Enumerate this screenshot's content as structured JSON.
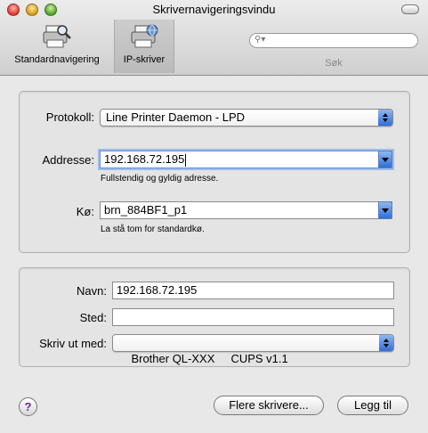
{
  "window": {
    "title": "Skrivernavigeringsvindu"
  },
  "toolbar": {
    "items": [
      {
        "label": "Standardnavigering",
        "icon": "printer-magnifier-icon"
      },
      {
        "label": "IP-skriver",
        "icon": "network-printer-icon",
        "selected": true
      }
    ],
    "search": {
      "placeholder": "",
      "label": "Søk"
    }
  },
  "ip_group": {
    "protocol_label": "Protokoll:",
    "protocol_value": "Line Printer Daemon - LPD",
    "address_label": "Addresse:",
    "address_value": "192.168.72.195",
    "address_hint": "Fullstendig og gyldig adresse.",
    "queue_label": "Kø:",
    "queue_value": "brn_884BF1_p1",
    "queue_hint": "La stå tom for standardkø."
  },
  "info_group": {
    "name_label": "Navn:",
    "name_value": "192.168.72.195",
    "location_label": "Sted:",
    "location_value": "",
    "print_with_label": "Skriv ut med:",
    "print_with_value": "Brother QL-XXX     CUPS v1.1"
  },
  "buttons": {
    "help": "?",
    "more_printers": "Flere skrivere...",
    "add": "Legg til"
  }
}
